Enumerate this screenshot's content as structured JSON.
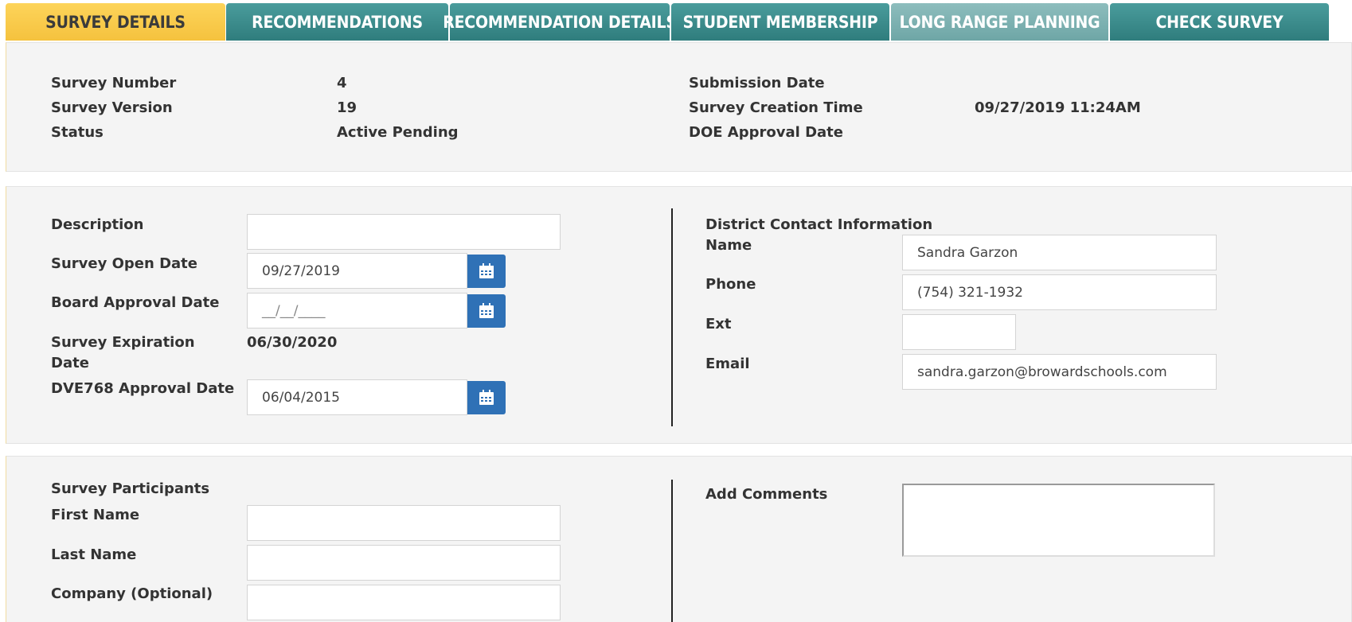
{
  "tabs": [
    {
      "label": "SURVEY DETAILS"
    },
    {
      "label": "RECOMMENDATIONS"
    },
    {
      "label": "RECOMMENDATION DETAILS"
    },
    {
      "label": "STUDENT MEMBERSHIP"
    },
    {
      "label": "LONG RANGE PLANNING"
    },
    {
      "label": "CHECK SURVEY"
    }
  ],
  "summary": {
    "survey_number_label": "Survey Number",
    "survey_number": "4",
    "survey_version_label": "Survey Version",
    "survey_version": "19",
    "status_label": "Status",
    "status": "Active Pending",
    "submission_date_label": "Submission Date",
    "submission_date": "",
    "creation_time_label": "Survey Creation Time",
    "creation_time": "09/27/2019 11:24AM",
    "doe_approval_label": "DOE Approval Date",
    "doe_approval": ""
  },
  "details": {
    "description_label": "Description",
    "description_value": "",
    "open_date_label": "Survey Open Date",
    "open_date_value": "09/27/2019",
    "board_approval_label": "Board Approval Date",
    "board_approval_placeholder": "__/__/____",
    "expiration_label_1": "Survey Expiration",
    "expiration_label_2": "Date",
    "expiration_value": "06/30/2020",
    "dve_label": "DVE768 Approval Date",
    "dve_value": "06/04/2015"
  },
  "contact": {
    "heading": "District Contact Information",
    "name_label": "Name",
    "name_value": "Sandra Garzon",
    "phone_label": "Phone",
    "phone_value": "(754) 321-1932",
    "ext_label": "Ext",
    "ext_value": "",
    "email_label": "Email",
    "email_value": "sandra.garzon@browardschools.com"
  },
  "participants": {
    "heading": "Survey Participants",
    "first_name_label": "First Name",
    "last_name_label": "Last Name",
    "company_label": "Company (Optional)"
  },
  "comments": {
    "label": "Add Comments"
  },
  "icons": {
    "calendar": "calendar-icon"
  },
  "colors": {
    "tab_teal": "#3a8a8a",
    "tab_active": "#f9cb4a",
    "calendar_button": "#2f71b6"
  }
}
